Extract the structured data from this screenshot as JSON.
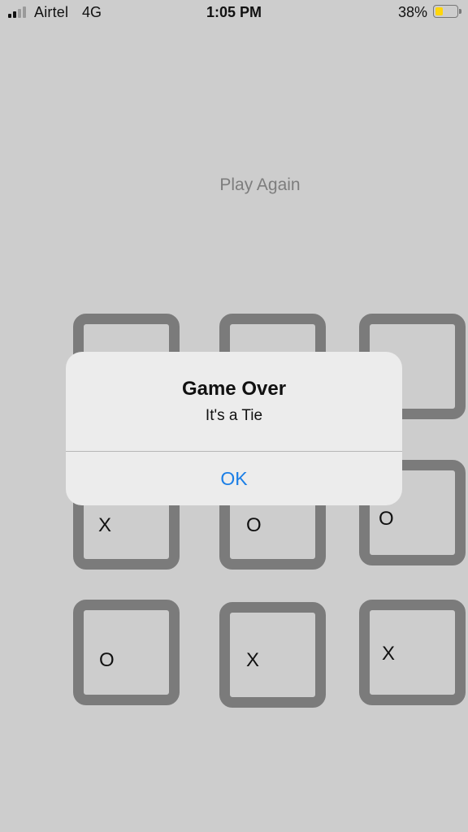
{
  "status_bar": {
    "carrier": "Airtel",
    "network": "4G",
    "time": "1:05 PM",
    "battery_percent": "38%",
    "battery_level": 0.38,
    "battery_color": "#ffd60a",
    "signal_bars_active": 2,
    "signal_bars_total": 4
  },
  "play_again_label": "Play Again",
  "board": {
    "cells": [
      "",
      "",
      "",
      "X",
      "O",
      "O",
      "O",
      "X",
      "X"
    ],
    "border_color": "#7b7b7b"
  },
  "alert": {
    "title": "Game Over",
    "message": "It's a Tie",
    "ok_label": "OK",
    "ok_color": "#1a7ee6"
  }
}
